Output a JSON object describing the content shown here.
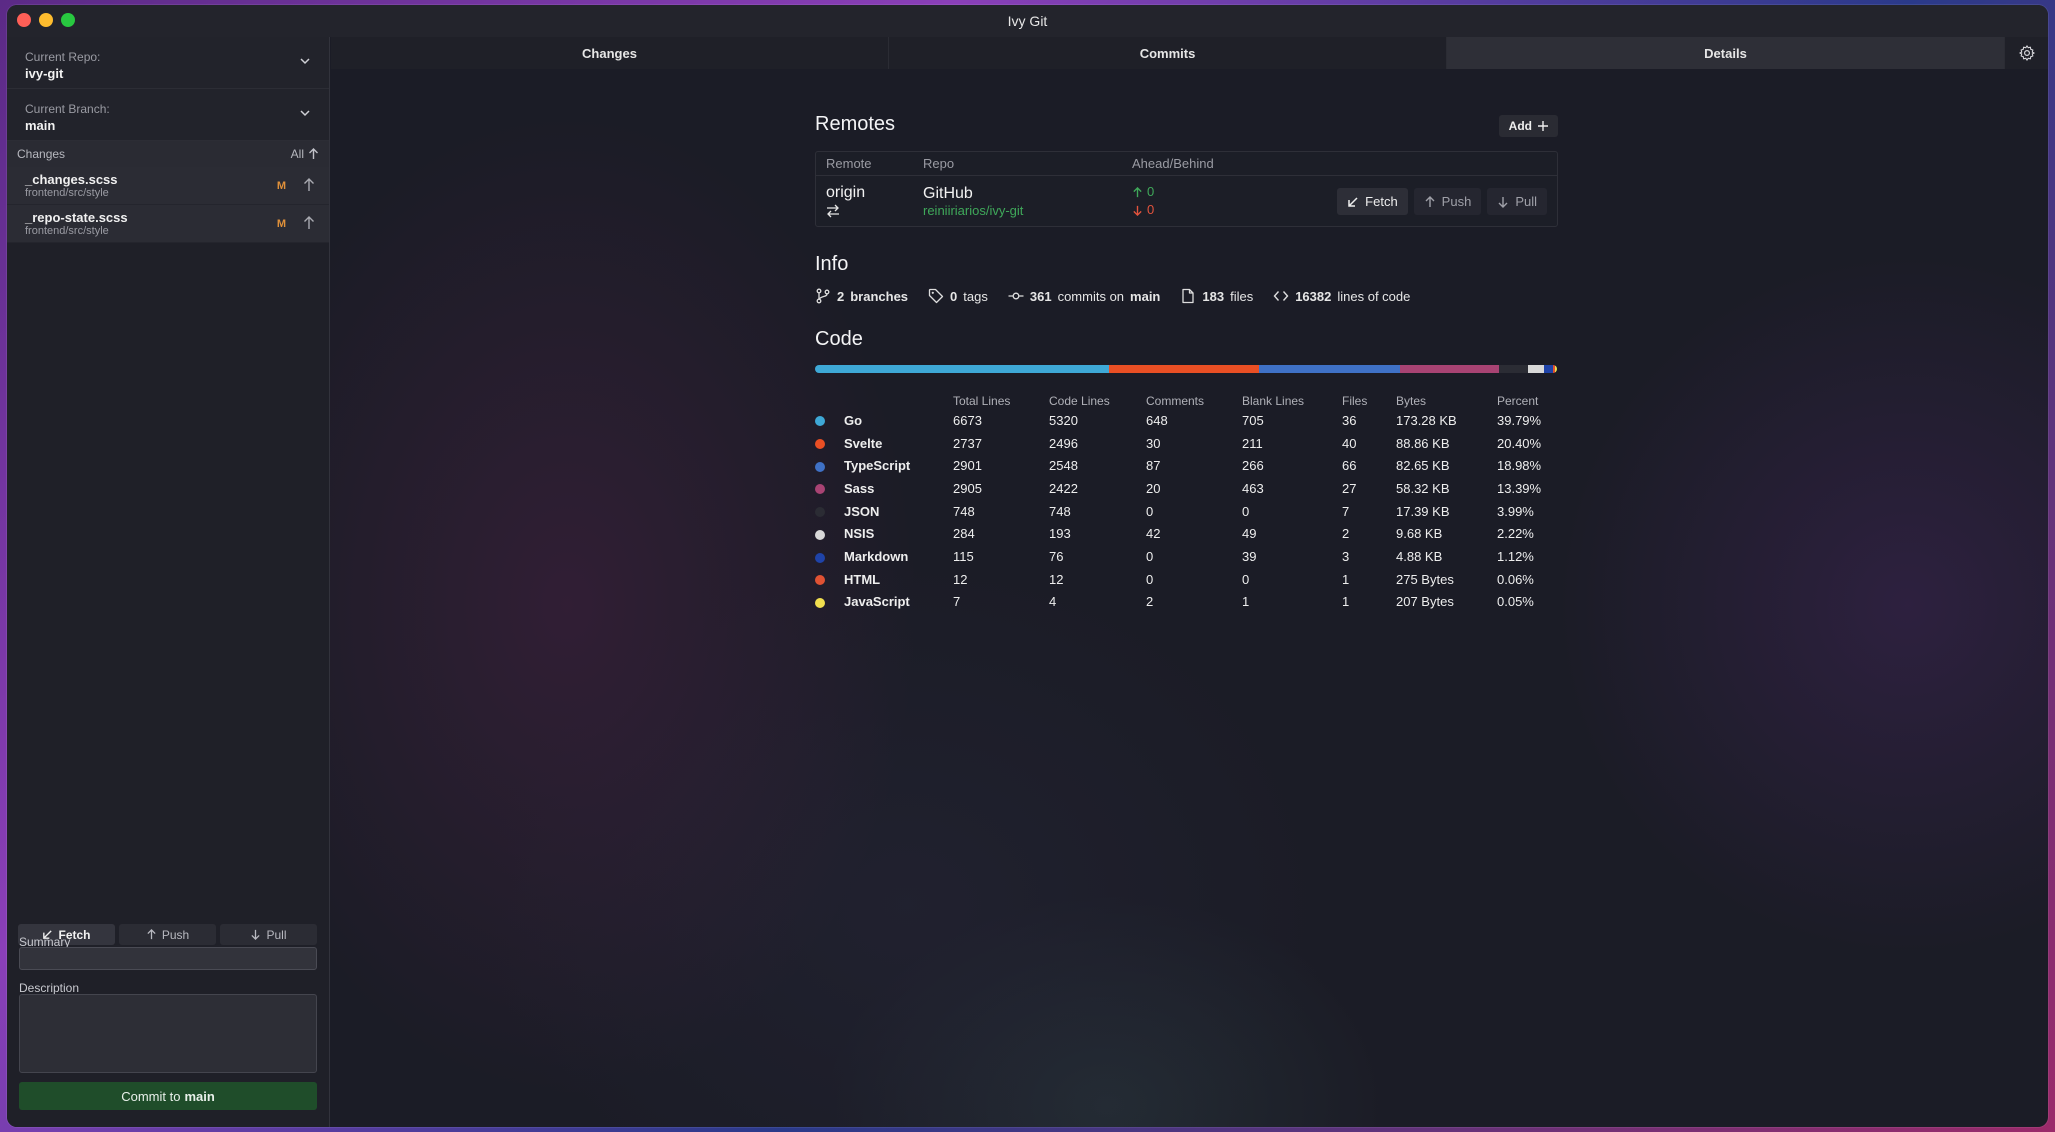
{
  "window": {
    "title": "Ivy Git"
  },
  "sidebar": {
    "repo_label": "Current Repo:",
    "repo_value": "ivy-git",
    "branch_label": "Current Branch:",
    "branch_value": "main",
    "changes_label": "Changes",
    "all_label": "All",
    "files": [
      {
        "name": "_changes.scss",
        "path": "frontend/src/style",
        "status": "M"
      },
      {
        "name": "_repo-state.scss",
        "path": "frontend/src/style",
        "status": "M"
      }
    ],
    "fetch_label": "Fetch",
    "push_label": "Push",
    "pull_label": "Pull",
    "summary_label": "Summary",
    "description_label": "Description",
    "commit_prefix": "Commit to",
    "commit_branch": "main"
  },
  "tabs": [
    {
      "label": "Changes",
      "active": false
    },
    {
      "label": "Commits",
      "active": false
    },
    {
      "label": "Details",
      "active": true
    }
  ],
  "remotes": {
    "title": "Remotes",
    "add_label": "Add",
    "headers": {
      "remote": "Remote",
      "repo": "Repo",
      "ahead_behind": "Ahead/Behind"
    },
    "rows": [
      {
        "name": "origin",
        "host": "GitHub",
        "repo": "reiniiriarios/ivy-git",
        "ahead": "0",
        "behind": "0",
        "fetch_label": "Fetch",
        "push_label": "Push",
        "pull_label": "Pull"
      }
    ]
  },
  "info": {
    "title": "Info",
    "branches_count": "2",
    "branches_label": "branches",
    "tags_count": "0",
    "tags_label": "tags",
    "commits_count": "361",
    "commits_label": "commits on",
    "commits_branch": "main",
    "files_count": "183",
    "files_label": "files",
    "lines_count": "16382",
    "lines_label": "lines of code"
  },
  "code": {
    "title": "Code",
    "headers": [
      "",
      "Total Lines",
      "Code Lines",
      "Comments",
      "Blank Lines",
      "Files",
      "Bytes",
      "Percent"
    ],
    "languages": [
      {
        "name": "Go",
        "color": "#3ea8d6",
        "total": "6673",
        "code": "5320",
        "comments": "648",
        "blank": "705",
        "files": "36",
        "bytes": "173.28 KB",
        "percent": "39.79%",
        "share": 39.79
      },
      {
        "name": "Svelte",
        "color": "#ea4f24",
        "total": "2737",
        "code": "2496",
        "comments": "30",
        "blank": "211",
        "files": "40",
        "bytes": "88.86 KB",
        "percent": "20.40%",
        "share": 20.4
      },
      {
        "name": "TypeScript",
        "color": "#3f71c6",
        "total": "2901",
        "code": "2548",
        "comments": "87",
        "blank": "266",
        "files": "66",
        "bytes": "82.65 KB",
        "percent": "18.98%",
        "share": 18.98
      },
      {
        "name": "Sass",
        "color": "#a84373",
        "total": "2905",
        "code": "2422",
        "comments": "20",
        "blank": "463",
        "files": "27",
        "bytes": "58.32 KB",
        "percent": "13.39%",
        "share": 13.39
      },
      {
        "name": "JSON",
        "color": "#2b2c34",
        "total": "748",
        "code": "748",
        "comments": "0",
        "blank": "0",
        "files": "7",
        "bytes": "17.39 KB",
        "percent": "3.99%",
        "share": 3.99
      },
      {
        "name": "NSIS",
        "color": "#d8d8d8",
        "total": "284",
        "code": "193",
        "comments": "42",
        "blank": "49",
        "files": "2",
        "bytes": "9.68 KB",
        "percent": "2.22%",
        "share": 2.22
      },
      {
        "name": "Markdown",
        "color": "#1f43a8",
        "total": "115",
        "code": "76",
        "comments": "0",
        "blank": "39",
        "files": "3",
        "bytes": "4.88 KB",
        "percent": "1.12%",
        "share": 1.12
      },
      {
        "name": "HTML",
        "color": "#e05233",
        "total": "12",
        "code": "12",
        "comments": "0",
        "blank": "0",
        "files": "1",
        "bytes": "275 Bytes",
        "percent": "0.06%",
        "share": 0.06
      },
      {
        "name": "JavaScript",
        "color": "#f1df4f",
        "total": "7",
        "code": "4",
        "comments": "2",
        "blank": "1",
        "files": "1",
        "bytes": "207 Bytes",
        "percent": "0.05%",
        "share": 0.05
      }
    ]
  }
}
